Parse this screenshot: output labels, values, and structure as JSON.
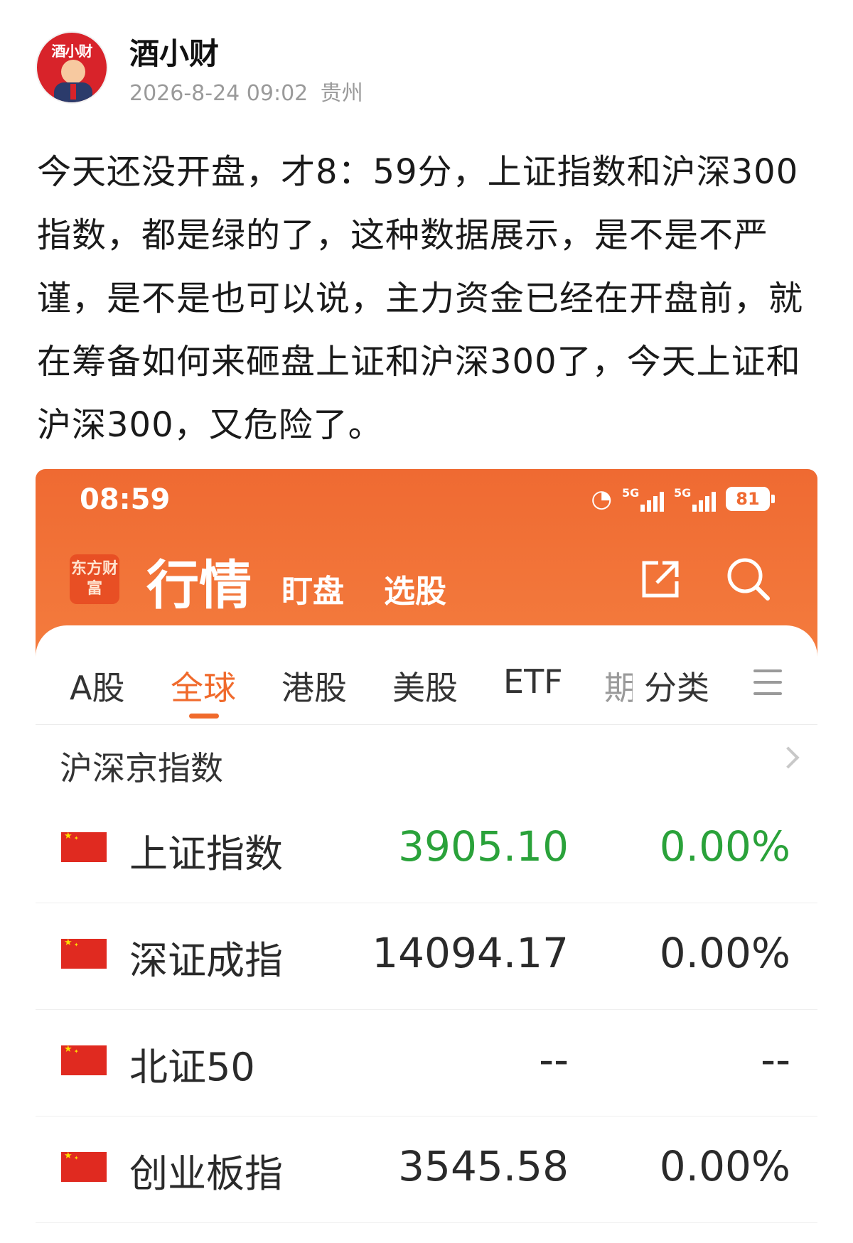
{
  "post": {
    "author": "酒小财",
    "avatar_text": "酒小财",
    "datetime": "2026-8-24 09:02",
    "location": "贵州",
    "body": "今天还没开盘，才8：59分，上证指数和沪深300指数，都是绿的了，这种数据展示，是不是不严谨，是不是也可以说，主力资金已经在开盘前，就在筹备如何来砸盘上证和沪深300了，今天上证和沪深300，又危险了。"
  },
  "app": {
    "status_bar": {
      "time": "08:59",
      "network_1": "5G",
      "network_2": "5G",
      "battery": "81"
    },
    "logo_text": "东方财富",
    "nav": {
      "title": "行情",
      "links": [
        "盯盘",
        "选股"
      ]
    },
    "tabs": [
      "A股",
      "全球",
      "港股",
      "美股",
      "ETF",
      "期",
      "分类"
    ],
    "active_tab": "全球",
    "section_title": "沪深京指数",
    "rows": [
      {
        "name": "上证指数",
        "price": "3905.10",
        "change": "0.00%",
        "color": "#2aa23a"
      },
      {
        "name": "深证成指",
        "price": "14094.17",
        "change": "0.00%",
        "color": "#2a2a2a"
      },
      {
        "name": "北证50",
        "price": "--",
        "change": "--",
        "color": "#2a2a2a"
      },
      {
        "name": "创业板指",
        "price": "3545.58",
        "change": "0.00%",
        "color": "#2a2a2a"
      }
    ],
    "colors": {
      "accent": "#ef6a32",
      "down_green": "#2aa23a"
    }
  }
}
